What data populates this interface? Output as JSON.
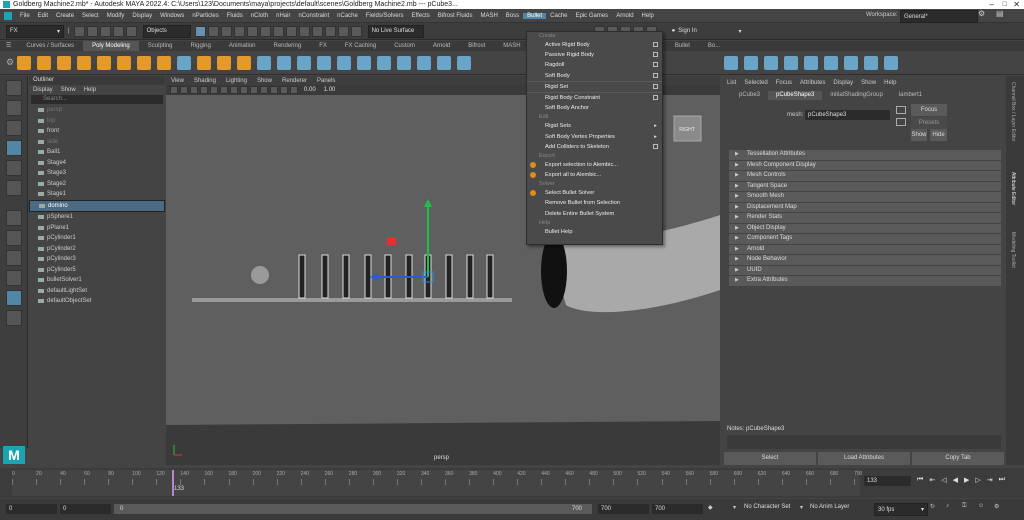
{
  "window": {
    "title": "Goldberg Machine2.mb* - Autodesk MAYA 2022.4: C:\\Users\\123\\Documents\\maya\\projects\\default\\scenes\\Goldberg Machine2.mb --- pCube3..."
  },
  "menubar": {
    "items": [
      "File",
      "Edit",
      "Create",
      "Select",
      "Modify",
      "Display",
      "Windows",
      "nParticles",
      "Fluids",
      "nCloth",
      "nHair",
      "nConstraint",
      "nCache",
      "Fields/Solvers",
      "Effects",
      "Bifrost Fluids",
      "MASH",
      "Boss",
      "Bullet",
      "Cache",
      "Epic Games",
      "Arnold",
      "Help"
    ],
    "active": "Bullet",
    "workspace_label": "Workspace:",
    "workspace_value": "General*"
  },
  "status_line": {
    "menuset": "FX",
    "objects": "Objects",
    "no_live_surface": "No Live Surface",
    "sign_in": "Sign In"
  },
  "shelf_tabs": [
    "Curves / Surfaces",
    "Poly Modeling",
    "Sculpting",
    "Rigging",
    "Animation",
    "Rendering",
    "FX",
    "FX Caching",
    "Custom",
    "Arnold",
    "Bifrost",
    "MASH",
    "Motion Graphics",
    "XGen",
    "TURTLE",
    "Bullet",
    "Bo..."
  ],
  "shelf_tab_active": "Poly Modeling",
  "outliner": {
    "title": "Outliner",
    "menu": [
      "Display",
      "Show",
      "Help"
    ],
    "search_placeholder": "Search...",
    "items": [
      {
        "label": "persp",
        "dim": true
      },
      {
        "label": "top",
        "dim": true
      },
      {
        "label": "front",
        "dim": false
      },
      {
        "label": "side",
        "dim": true
      },
      {
        "label": "Ball1",
        "dim": false
      },
      {
        "label": "Stage4",
        "dim": false
      },
      {
        "label": "Stage3",
        "dim": false
      },
      {
        "label": "Stage2",
        "dim": false
      },
      {
        "label": "Stage1",
        "dim": false
      },
      {
        "label": "domino",
        "dim": false,
        "selected": true
      },
      {
        "label": "pSphere1",
        "dim": false
      },
      {
        "label": "pPlane1",
        "dim": false
      },
      {
        "label": "pCylinder1",
        "dim": false
      },
      {
        "label": "pCylinder2",
        "dim": false
      },
      {
        "label": "pCylinder3",
        "dim": false
      },
      {
        "label": "pCylinder5",
        "dim": false
      },
      {
        "label": "bulletSolver1",
        "dim": false
      },
      {
        "label": "defaultLightSet",
        "dim": false
      },
      {
        "label": "defaultObjectSet",
        "dim": false
      }
    ]
  },
  "viewport": {
    "menu": [
      "View",
      "Shading",
      "Lighting",
      "Show",
      "Renderer",
      "Panels"
    ],
    "camera_label": "persp",
    "exposure": "0.00",
    "gamma": "1.00",
    "viewcube_label": "RIGHT"
  },
  "bullet_menu": {
    "sections": [
      {
        "header": "Create",
        "items": [
          {
            "label": "Active Rigid Body",
            "option": true
          },
          {
            "label": "Passive Rigid Body",
            "option": true
          },
          {
            "label": "Ragdoll",
            "option": true
          },
          {
            "label": "Soft Body",
            "option": true
          },
          {
            "label": "Rigid Set",
            "option": true,
            "divider_before": true
          },
          {
            "label": "Rigid Body Constraint",
            "option": true,
            "divider_before": true
          },
          {
            "label": "Soft Body Anchor",
            "option": false
          }
        ]
      },
      {
        "header": "Edit",
        "items": [
          {
            "label": "Rigid Sets",
            "submenu": true
          },
          {
            "label": "Soft Body Vertex Properties",
            "submenu": true
          },
          {
            "label": "Add Colliders to Skeleton",
            "option": true
          }
        ]
      },
      {
        "header": "Export",
        "items": [
          {
            "label": "Export selection to Alembic...",
            "icon": true
          },
          {
            "label": "Export all to Alembic...",
            "icon": true
          }
        ]
      },
      {
        "header": "Solver",
        "items": [
          {
            "label": "Select Bullet Solver",
            "icon": true
          },
          {
            "label": "Remove Bullet from Selection"
          },
          {
            "label": "Delete Entire Bullet System"
          }
        ]
      },
      {
        "header": "Help",
        "items": [
          {
            "label": "Bullet Help"
          }
        ]
      }
    ]
  },
  "attribute_editor": {
    "menu": [
      "List",
      "Selected",
      "Focus",
      "Attributes",
      "Display",
      "Show",
      "Help"
    ],
    "tabs": [
      "pCube3",
      "pCubeShape3",
      "initialShadingGroup",
      "lambert1"
    ],
    "active_tab": "pCubeShape3",
    "node_label": "mesh:",
    "node_value": "pCubeShape3",
    "focus_button": "Focus",
    "presets_button": "Presets",
    "show_button": "Show",
    "hide_button": "Hide",
    "sections": [
      "Tessellation Attributes",
      "Mesh Component Display",
      "Mesh Controls",
      "Tangent Space",
      "Smooth Mesh",
      "Displacement Map",
      "Render Stats",
      "Object Display",
      "Component Tags",
      "Arnold",
      "Node Behavior",
      "UUID",
      "Extra Attributes"
    ],
    "notes_label": "Notes:",
    "notes_value": "pCubeShape3",
    "buttons": [
      "Select",
      "Load Attributes",
      "Copy Tab"
    ]
  },
  "side_tabs": [
    "Channel Box / Layer Editor",
    "Attribute Editor",
    "Modeling Toolkit"
  ],
  "time_slider": {
    "ticks": [
      "0",
      "10",
      "20",
      "30",
      "40",
      "50",
      "60",
      "70",
      "80",
      "90",
      "100",
      "110",
      "120",
      "130",
      "140",
      "150",
      "160",
      "170",
      "180",
      "190",
      "200",
      "210",
      "220",
      "230",
      "240",
      "250",
      "260",
      "270",
      "280",
      "290",
      "300",
      "310",
      "320",
      "330",
      "340",
      "350",
      "360",
      "370",
      "380",
      "390",
      "400",
      "410",
      "420",
      "430",
      "440",
      "450",
      "460",
      "470",
      "480",
      "490",
      "500",
      "510",
      "520",
      "530",
      "540",
      "550",
      "560",
      "570",
      "580",
      "590",
      "600",
      "610",
      "620",
      "630",
      "640",
      "650",
      "660",
      "670",
      "680",
      "690",
      "700"
    ],
    "current_frame": "133",
    "current_field": "133"
  },
  "range_slider": {
    "start": "0",
    "anim_start": "0",
    "range_start_handle": "0",
    "range_end_handle": "700",
    "range_end": "700",
    "anim_end": "700",
    "character_set": "No Character Set",
    "anim_layer": "No Anim Layer",
    "fps": "30 fps"
  }
}
